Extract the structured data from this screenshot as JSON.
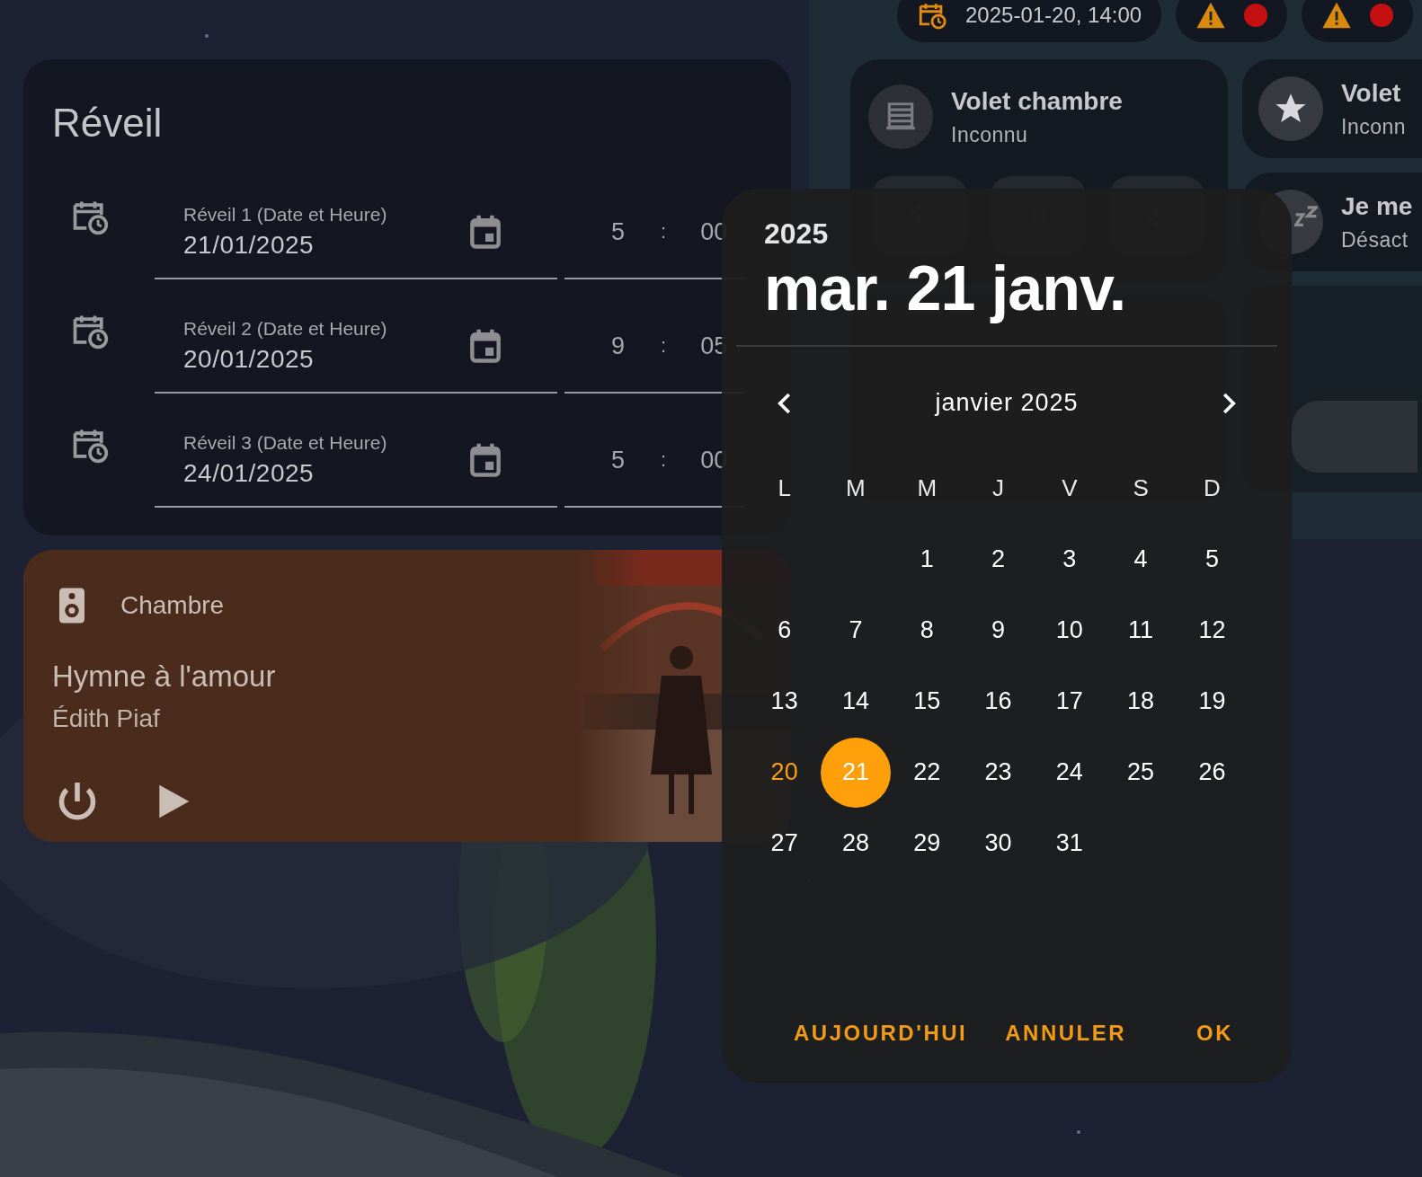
{
  "status_chips": [
    {
      "kind": "datetime",
      "text": "2025-01-20, 14:00"
    },
    {
      "kind": "alerts"
    },
    {
      "kind": "alerts"
    }
  ],
  "alarm_card": {
    "title": "Réveil",
    "alarms": [
      {
        "label": "Réveil 1 (Date et Heure)",
        "date": "21/01/2025",
        "hour": "5",
        "separator": ":",
        "minute": "00"
      },
      {
        "label": "Réveil 2 (Date et Heure)",
        "date": "20/01/2025",
        "hour": "9",
        "separator": ":",
        "minute": "05"
      },
      {
        "label": "Réveil 3 (Date et Heure)",
        "date": "24/01/2025",
        "hour": "5",
        "separator": ":",
        "minute": "00"
      }
    ]
  },
  "media_card": {
    "room": "Chambre",
    "title": "Hymne à l'amour",
    "artist": "Édith Piaf"
  },
  "shutter_card": {
    "name": "Volet chambre",
    "state": "Inconnu"
  },
  "side_cards": [
    {
      "kind": "star",
      "name": "Volet",
      "state": "Inconn"
    },
    {
      "kind": "sleep",
      "name": "Je me",
      "state": "Désact"
    }
  ],
  "date_picker": {
    "year": "2025",
    "date": "mar. 21 janv.",
    "month": "janvier 2025",
    "weekdays": [
      "L",
      "M",
      "M",
      "J",
      "V",
      "S",
      "D"
    ],
    "weeks": [
      [
        {
          "label": "1",
          "selected": false,
          "today": false
        },
        {
          "label": "2",
          "selected": false,
          "today": false
        },
        {
          "label": "3",
          "selected": false,
          "today": false
        },
        {
          "label": "4",
          "selected": false,
          "today": false
        },
        {
          "label": "5",
          "selected": false,
          "today": false
        }
      ],
      [
        {
          "label": "6",
          "selected": false,
          "today": false
        },
        {
          "label": "7",
          "selected": false,
          "today": false
        },
        {
          "label": "8",
          "selected": false,
          "today": false
        },
        {
          "label": "9",
          "selected": false,
          "today": false
        },
        {
          "label": "10",
          "selected": false,
          "today": false
        },
        {
          "label": "11",
          "selected": false,
          "today": false
        },
        {
          "label": "12",
          "selected": false,
          "today": false
        }
      ],
      [
        {
          "label": "13",
          "selected": false,
          "today": false
        },
        {
          "label": "14",
          "selected": false,
          "today": false
        },
        {
          "label": "15",
          "selected": false,
          "today": false
        },
        {
          "label": "16",
          "selected": false,
          "today": false
        },
        {
          "label": "17",
          "selected": false,
          "today": false
        },
        {
          "label": "18",
          "selected": false,
          "today": false
        },
        {
          "label": "19",
          "selected": false,
          "today": false
        }
      ],
      [
        {
          "label": "20",
          "selected": false,
          "today": true
        },
        {
          "label": "21",
          "selected": true,
          "today": false
        },
        {
          "label": "22",
          "selected": false,
          "today": false
        },
        {
          "label": "23",
          "selected": false,
          "today": false
        },
        {
          "label": "24",
          "selected": false,
          "today": false
        },
        {
          "label": "25",
          "selected": false,
          "today": false
        },
        {
          "label": "26",
          "selected": false,
          "today": false
        }
      ],
      [
        {
          "label": "27",
          "selected": false,
          "today": false
        },
        {
          "label": "28",
          "selected": false,
          "today": false
        },
        {
          "label": "29",
          "selected": false,
          "today": false
        },
        {
          "label": "30",
          "selected": false,
          "today": false
        },
        {
          "label": "31",
          "selected": false,
          "today": false
        }
      ]
    ],
    "buttons": [
      "AUJOURD'HUI",
      "ANNULER",
      "OK"
    ]
  }
}
